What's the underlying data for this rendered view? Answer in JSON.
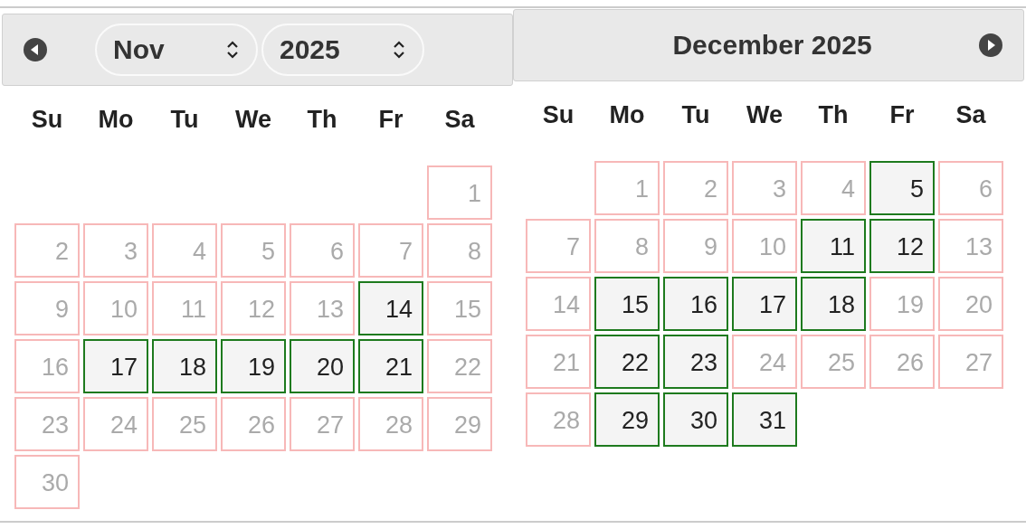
{
  "months": [
    {
      "kind": "selects",
      "prev_arrow": true,
      "next_arrow": false,
      "month_select": "Nov",
      "year_select": "2025",
      "weekdays": [
        "Su",
        "Mo",
        "Tu",
        "We",
        "Th",
        "Fr",
        "Sa"
      ],
      "weeks": [
        [
          {
            "kind": "empty"
          },
          {
            "kind": "empty"
          },
          {
            "kind": "empty"
          },
          {
            "kind": "empty"
          },
          {
            "kind": "empty"
          },
          {
            "kind": "empty"
          },
          {
            "kind": "day",
            "day": "1",
            "available": false
          }
        ],
        [
          {
            "kind": "day",
            "day": "2",
            "available": false
          },
          {
            "kind": "day",
            "day": "3",
            "available": false
          },
          {
            "kind": "day",
            "day": "4",
            "available": false
          },
          {
            "kind": "day",
            "day": "5",
            "available": false
          },
          {
            "kind": "day",
            "day": "6",
            "available": false
          },
          {
            "kind": "day",
            "day": "7",
            "available": false
          },
          {
            "kind": "day",
            "day": "8",
            "available": false
          }
        ],
        [
          {
            "kind": "day",
            "day": "9",
            "available": false
          },
          {
            "kind": "day",
            "day": "10",
            "available": false
          },
          {
            "kind": "day",
            "day": "11",
            "available": false
          },
          {
            "kind": "day",
            "day": "12",
            "available": false
          },
          {
            "kind": "day",
            "day": "13",
            "available": false
          },
          {
            "kind": "day",
            "day": "14",
            "available": true
          },
          {
            "kind": "day",
            "day": "15",
            "available": false
          }
        ],
        [
          {
            "kind": "day",
            "day": "16",
            "available": false
          },
          {
            "kind": "day",
            "day": "17",
            "available": true
          },
          {
            "kind": "day",
            "day": "18",
            "available": true
          },
          {
            "kind": "day",
            "day": "19",
            "available": true
          },
          {
            "kind": "day",
            "day": "20",
            "available": true
          },
          {
            "kind": "day",
            "day": "21",
            "available": true
          },
          {
            "kind": "day",
            "day": "22",
            "available": false
          }
        ],
        [
          {
            "kind": "day",
            "day": "23",
            "available": false
          },
          {
            "kind": "day",
            "day": "24",
            "available": false
          },
          {
            "kind": "day",
            "day": "25",
            "available": false
          },
          {
            "kind": "day",
            "day": "26",
            "available": false
          },
          {
            "kind": "day",
            "day": "27",
            "available": false
          },
          {
            "kind": "day",
            "day": "28",
            "available": false
          },
          {
            "kind": "day",
            "day": "29",
            "available": false
          }
        ],
        [
          {
            "kind": "day",
            "day": "30",
            "available": false
          }
        ]
      ]
    },
    {
      "kind": "title",
      "prev_arrow": false,
      "next_arrow": true,
      "title": "December 2025",
      "weekdays": [
        "Su",
        "Mo",
        "Tu",
        "We",
        "Th",
        "Fr",
        "Sa"
      ],
      "weeks": [
        [
          {
            "kind": "empty"
          },
          {
            "kind": "day",
            "day": "1",
            "available": false
          },
          {
            "kind": "day",
            "day": "2",
            "available": false
          },
          {
            "kind": "day",
            "day": "3",
            "available": false
          },
          {
            "kind": "day",
            "day": "4",
            "available": false
          },
          {
            "kind": "day",
            "day": "5",
            "available": true
          },
          {
            "kind": "day",
            "day": "6",
            "available": false
          }
        ],
        [
          {
            "kind": "day",
            "day": "7",
            "available": false
          },
          {
            "kind": "day",
            "day": "8",
            "available": false
          },
          {
            "kind": "day",
            "day": "9",
            "available": false
          },
          {
            "kind": "day",
            "day": "10",
            "available": false
          },
          {
            "kind": "day",
            "day": "11",
            "available": true
          },
          {
            "kind": "day",
            "day": "12",
            "available": true
          },
          {
            "kind": "day",
            "day": "13",
            "available": false
          }
        ],
        [
          {
            "kind": "day",
            "day": "14",
            "available": false
          },
          {
            "kind": "day",
            "day": "15",
            "available": true
          },
          {
            "kind": "day",
            "day": "16",
            "available": true
          },
          {
            "kind": "day",
            "day": "17",
            "available": true
          },
          {
            "kind": "day",
            "day": "18",
            "available": true
          },
          {
            "kind": "day",
            "day": "19",
            "available": false
          },
          {
            "kind": "day",
            "day": "20",
            "available": false
          }
        ],
        [
          {
            "kind": "day",
            "day": "21",
            "available": false
          },
          {
            "kind": "day",
            "day": "22",
            "available": true
          },
          {
            "kind": "day",
            "day": "23",
            "available": true
          },
          {
            "kind": "day",
            "day": "24",
            "available": false
          },
          {
            "kind": "day",
            "day": "25",
            "available": false
          },
          {
            "kind": "day",
            "day": "26",
            "available": false
          },
          {
            "kind": "day",
            "day": "27",
            "available": false
          }
        ],
        [
          {
            "kind": "day",
            "day": "28",
            "available": false
          },
          {
            "kind": "day",
            "day": "29",
            "available": true
          },
          {
            "kind": "day",
            "day": "30",
            "available": true
          },
          {
            "kind": "day",
            "day": "31",
            "available": true
          }
        ]
      ]
    }
  ]
}
